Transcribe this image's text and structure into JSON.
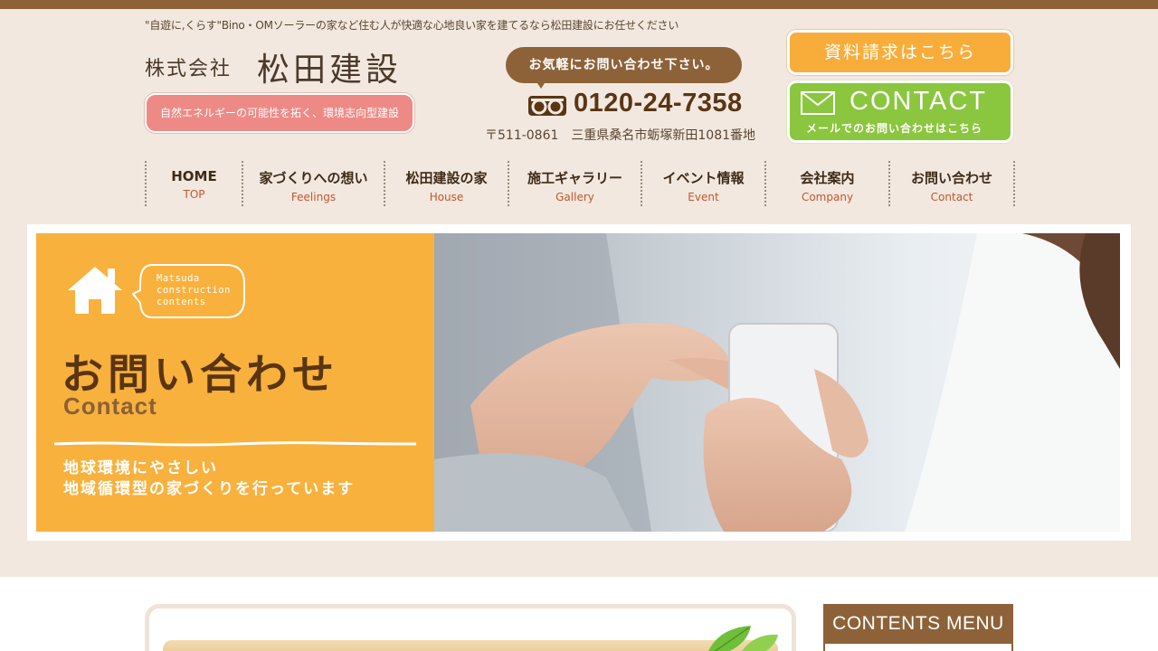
{
  "header": {
    "tagline": "\"自遊に,くらす\"Bino・OMソーラーの家など住む人が快適な心地良い家を建てるなら松田建設にお任せください",
    "logo_small": "株式会社",
    "logo_big": "松田建設",
    "logo_pill": "自然エネルギーの可能性を拓く、環境志向型建設",
    "bubble": "お気軽にお問い合わせ下さい。",
    "phone": "0120-24-7358",
    "address": "〒511-0861　三重県桑名市蛎塚新田1081番地",
    "doc_button": "資料請求はこちら",
    "contact_button": {
      "big": "CONTACT",
      "small": "メールでのお問い合わせはこちら"
    }
  },
  "nav": [
    {
      "jp": "HOME",
      "en": "TOP"
    },
    {
      "jp": "家づくりへの想い",
      "en": "Feelings"
    },
    {
      "jp": "松田建設の家",
      "en": "House"
    },
    {
      "jp": "施工ギャラリー",
      "en": "Gallery"
    },
    {
      "jp": "イベント情報",
      "en": "Event"
    },
    {
      "jp": "会社案内",
      "en": "Company"
    },
    {
      "jp": "お問い合わせ",
      "en": "Contact"
    }
  ],
  "hero": {
    "speech_lines": [
      "Matsuda",
      "construction",
      "contents"
    ],
    "title": "お問い合わせ",
    "subtitle": "Contact",
    "message_lines": [
      "地球環境にやさしい",
      "地域循環型の家づくりを行っています"
    ]
  },
  "sidebar": {
    "menu_title": "CONTENTS MENU"
  },
  "colors": {
    "brown": "#8e6238",
    "orange": "#f8b13d",
    "green": "#8bc63f",
    "pink": "#ee8a86",
    "beige": "#f2e8df"
  },
  "icons": [
    "free-dial-icon",
    "envelope-icon",
    "house-icon",
    "leaf-icon"
  ]
}
